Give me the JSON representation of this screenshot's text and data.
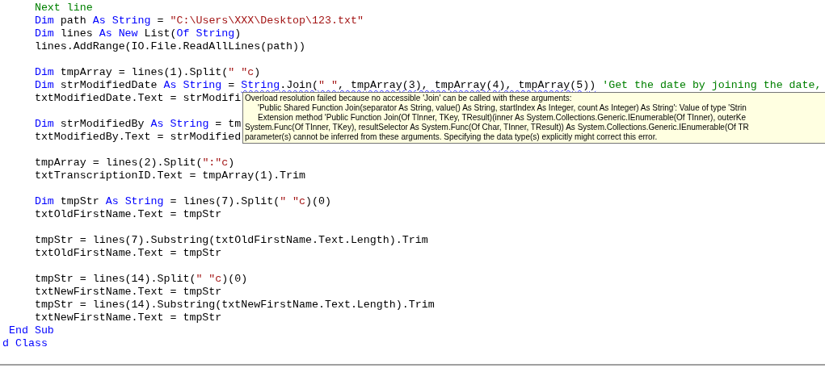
{
  "editor": {
    "lines": [
      {
        "kind": "code",
        "segments": [
          {
            "text": "     Next line",
            "kind": "comment"
          }
        ]
      },
      {
        "kind": "code",
        "segments": [
          {
            "text": "     Dim",
            "kind": "keyword"
          },
          {
            "text": " path ",
            "kind": "plain"
          },
          {
            "text": "As String",
            "kind": "keyword"
          },
          {
            "text": " = ",
            "kind": "plain"
          },
          {
            "text": "\"C:\\Users\\XXX\\Desktop\\123.txt\"",
            "kind": "string"
          }
        ]
      },
      {
        "kind": "code",
        "segments": [
          {
            "text": "     Dim",
            "kind": "keyword"
          },
          {
            "text": " lines ",
            "kind": "plain"
          },
          {
            "text": "As New",
            "kind": "keyword"
          },
          {
            "text": " List(",
            "kind": "plain"
          },
          {
            "text": "Of String",
            "kind": "keyword"
          },
          {
            "text": ")",
            "kind": "plain"
          }
        ]
      },
      {
        "kind": "code",
        "segments": [
          {
            "text": "     lines.AddRange(IO.File.ReadAllLines(path))",
            "kind": "plain"
          }
        ]
      },
      {
        "kind": "blank"
      },
      {
        "kind": "code",
        "segments": [
          {
            "text": "     Dim",
            "kind": "keyword"
          },
          {
            "text": " tmpArray = lines(1).Split(",
            "kind": "plain"
          },
          {
            "text": "\" \"c",
            "kind": "string"
          },
          {
            "text": ")",
            "kind": "plain"
          }
        ]
      },
      {
        "kind": "code",
        "segments": [
          {
            "text": "     Dim",
            "kind": "keyword"
          },
          {
            "text": " strModifiedDate ",
            "kind": "plain"
          },
          {
            "text": "As String",
            "kind": "keyword"
          },
          {
            "text": " = ",
            "kind": "plain"
          },
          {
            "text": "String",
            "kind": "keyword",
            "error": true
          },
          {
            "text": ".Join(",
            "kind": "plain",
            "error": true
          },
          {
            "text": "\" \"",
            "kind": "string",
            "error": true
          },
          {
            "text": ", tmpArray(3), tmpArray(4), tmpArray(5))",
            "kind": "plain",
            "error": true
          },
          {
            "text": " 'Get the date by joining the date,",
            "kind": "comment"
          }
        ]
      },
      {
        "kind": "code",
        "segments": [
          {
            "text": "     txtModifiedDate.Text = strModifi",
            "kind": "plain"
          }
        ]
      },
      {
        "kind": "blank"
      },
      {
        "kind": "code",
        "segments": [
          {
            "text": "     Dim",
            "kind": "keyword"
          },
          {
            "text": " strModifiedBy ",
            "kind": "plain"
          },
          {
            "text": "As String",
            "kind": "keyword"
          },
          {
            "text": " = tm",
            "kind": "plain"
          }
        ]
      },
      {
        "kind": "code",
        "segments": [
          {
            "text": "     txtModifiedBy.Text = strModified",
            "kind": "plain"
          }
        ]
      },
      {
        "kind": "blank"
      },
      {
        "kind": "code",
        "segments": [
          {
            "text": "     tmpArray = lines(2).Split(",
            "kind": "plain"
          },
          {
            "text": "\":\"c",
            "kind": "string"
          },
          {
            "text": ")",
            "kind": "plain"
          }
        ]
      },
      {
        "kind": "code",
        "segments": [
          {
            "text": "     txtTranscriptionID.Text = tmpArray(1).Trim",
            "kind": "plain"
          }
        ]
      },
      {
        "kind": "blank"
      },
      {
        "kind": "code",
        "segments": [
          {
            "text": "     Dim",
            "kind": "keyword"
          },
          {
            "text": " tmpStr ",
            "kind": "plain"
          },
          {
            "text": "As String",
            "kind": "keyword"
          },
          {
            "text": " = lines(7).Split(",
            "kind": "plain"
          },
          {
            "text": "\" \"c",
            "kind": "string"
          },
          {
            "text": ")(0)",
            "kind": "plain"
          }
        ]
      },
      {
        "kind": "code",
        "segments": [
          {
            "text": "     txtOldFirstName.Text = tmpStr",
            "kind": "plain"
          }
        ]
      },
      {
        "kind": "blank"
      },
      {
        "kind": "code",
        "segments": [
          {
            "text": "     tmpStr = lines(7).Substring(txtOldFirstName.Text.Length).Trim",
            "kind": "plain"
          }
        ]
      },
      {
        "kind": "code",
        "segments": [
          {
            "text": "     txtOldFirstName.Text = tmpStr",
            "kind": "plain"
          }
        ]
      },
      {
        "kind": "blank"
      },
      {
        "kind": "code",
        "segments": [
          {
            "text": "     tmpStr = lines(14).Split(",
            "kind": "plain"
          },
          {
            "text": "\" \"c",
            "kind": "string"
          },
          {
            "text": ")(0)",
            "kind": "plain"
          }
        ]
      },
      {
        "kind": "code",
        "segments": [
          {
            "text": "     txtNewFirstName.Text = tmpStr",
            "kind": "plain"
          }
        ]
      },
      {
        "kind": "code",
        "segments": [
          {
            "text": "     tmpStr = lines(14).Substring(txtNewFirstName.Text.Length).Trim",
            "kind": "plain"
          }
        ]
      },
      {
        "kind": "code",
        "segments": [
          {
            "text": "     txtNewFirstName.Text = tmpStr",
            "kind": "plain"
          }
        ]
      },
      {
        "kind": "code",
        "segments": [
          {
            "text": " End Sub",
            "kind": "keyword"
          }
        ]
      },
      {
        "kind": "code",
        "segments": [
          {
            "text": "d Class",
            "kind": "keyword"
          }
        ]
      }
    ]
  },
  "tooltip": {
    "lines": [
      {
        "text": "Overload resolution failed because no accessible 'Join' can be called with these arguments:",
        "indented": false
      },
      {
        "text": "'Public Shared Function Join(separator As String, value() As String, startIndex As Integer, count As Integer) As String': Value of type 'Strin",
        "indented": true
      },
      {
        "text": "Extension method 'Public Function Join(Of TInner, TKey, TResult)(inner As System.Collections.Generic.IEnumerable(Of TInner), outerKe",
        "indented": true
      },
      {
        "text": "System.Func(Of TInner, TKey), resultSelector As System.Func(Of Char, TInner, TResult)) As System.Collections.Generic.IEnumerable(Of TR",
        "indented": false
      },
      {
        "text": "parameter(s) cannot be inferred from these arguments. Specifying the data type(s) explicitly might correct this error.",
        "indented": false
      }
    ]
  }
}
